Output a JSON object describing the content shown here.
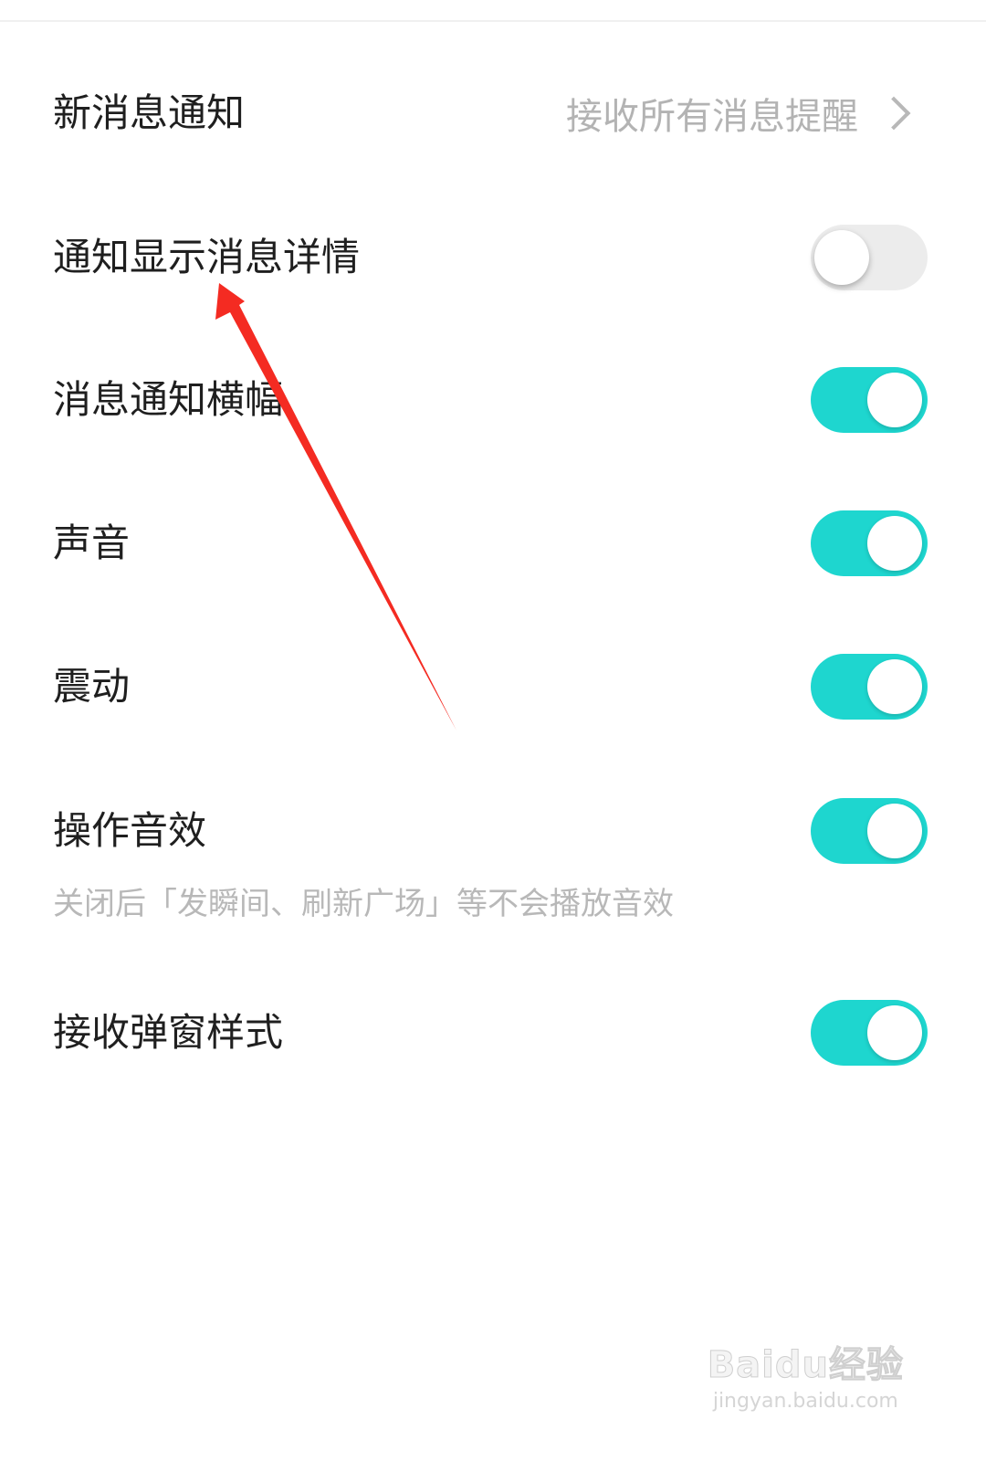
{
  "settings": {
    "new_message_notice": {
      "label": "新消息通知",
      "value": "接收所有消息提醒"
    },
    "show_details": {
      "label": "通知显示消息详情",
      "enabled": false
    },
    "banner": {
      "label": "消息通知横幅",
      "enabled": true
    },
    "sound": {
      "label": "声音",
      "enabled": true
    },
    "vibration": {
      "label": "震动",
      "enabled": true
    },
    "operation_sound": {
      "label": "操作音效",
      "enabled": true,
      "hint": "关闭后「发瞬间、刷新广场」等不会播放音效"
    },
    "popup_style": {
      "label": "接收弹窗样式",
      "enabled": true
    }
  },
  "colors": {
    "accent": "#1ed6cf",
    "toggle_off": "#ececec",
    "secondary_text": "#b3b3b3",
    "annotation_arrow": "#f42b22"
  },
  "watermark": {
    "brand": "Baidu经验",
    "url": "jingyan.baidu.com"
  }
}
